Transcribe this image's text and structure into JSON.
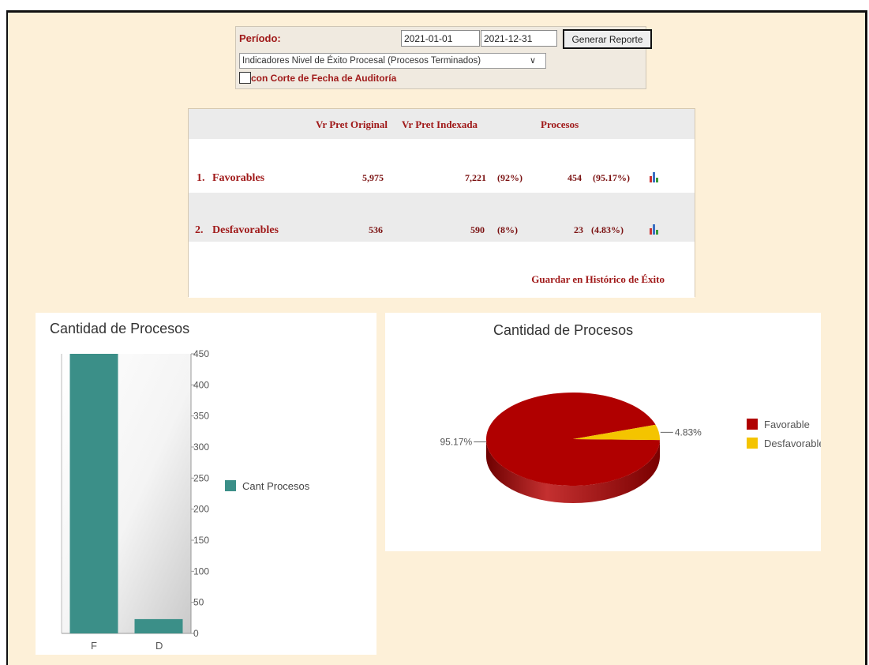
{
  "filter": {
    "periodo_label": "Período:",
    "date_from": "2021-01-01",
    "date_to": "2021-12-31",
    "generate_button": "Generar Reporte",
    "indicator_select": "Indicadores Nivel de Éxito Procesal (Procesos Terminados)",
    "audit_cutoff_label": "con Corte de Fecha de Auditoría",
    "audit_cutoff_checked": false
  },
  "summary": {
    "headers": {
      "vr_pret_original": "Vr Pret Original",
      "vr_pret_indexada": "Vr Pret Indexada",
      "procesos": "Procesos"
    },
    "rows": [
      {
        "index": "1.",
        "name": "Favorables",
        "original": "5,975",
        "indexada": "7,221",
        "indexada_pct": "(92%)",
        "procesos": "454",
        "procesos_pct": "(95.17%)"
      },
      {
        "index": "2.",
        "name": "Desfavorables",
        "original": "536",
        "indexada": "590",
        "indexada_pct": "(8%)",
        "procesos": "23",
        "procesos_pct": "(4.83%)"
      }
    ],
    "save_link": "Guardar en Histórico de Éxito"
  },
  "chart_data": [
    {
      "type": "bar",
      "title": "Cantidad de Procesos",
      "categories": [
        "F",
        "D"
      ],
      "series": [
        {
          "name": "Cant Procesos",
          "values": [
            454,
            23
          ]
        }
      ],
      "ylim": [
        0,
        450
      ],
      "yticks": [
        "0",
        "50",
        "100",
        "150",
        "200",
        "250",
        "300",
        "350",
        "400",
        "450"
      ],
      "axis_position": "right",
      "legend": "right",
      "color": "#3b8f88"
    },
    {
      "type": "pie",
      "title": "Cantidad de Procesos",
      "labels": [
        "Favorable",
        "Desfavorable"
      ],
      "values": [
        95.17,
        4.83
      ],
      "value_labels": [
        "95.17%",
        "4.83%"
      ],
      "colors": [
        "#b00000",
        "#f4c400"
      ],
      "legend": "right",
      "style": "3d"
    }
  ]
}
